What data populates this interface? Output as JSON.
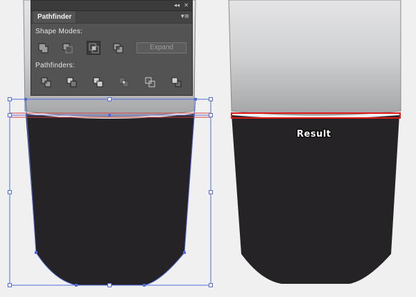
{
  "panel": {
    "tab_title": "Pathfinder",
    "collapse_glyph": "◂◂",
    "close_glyph": "✕",
    "menu_glyph": "▾≡",
    "shape_modes_label": "Shape Modes:",
    "pathfinders_label": "Pathfinders:",
    "expand_label": "Expand",
    "shape_mode_buttons": [
      "unite-icon",
      "minus-front-icon",
      "intersect-icon",
      "exclude-icon"
    ],
    "pathfinder_buttons": [
      "divide-icon",
      "trim-icon",
      "merge-icon",
      "crop-icon",
      "outline-icon",
      "minus-back-icon"
    ]
  },
  "artwork": {
    "result_label": "Result",
    "body_color": "#252325",
    "selection_color": "#4f6bdc",
    "highlight_color": "#e01818"
  }
}
